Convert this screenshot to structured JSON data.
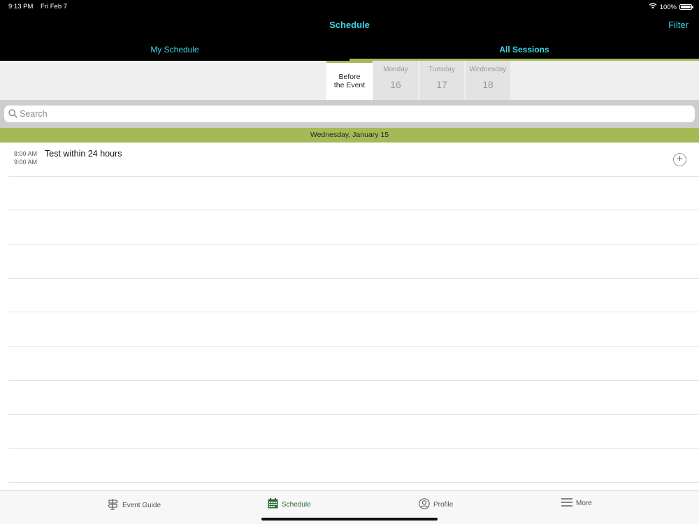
{
  "status": {
    "time": "9:13 PM",
    "date": "Fri Feb 7",
    "battery": "100%"
  },
  "nav": {
    "title": "Schedule",
    "filter": "Filter"
  },
  "segments": {
    "left": "My Schedule",
    "right": "All Sessions",
    "selected": "All Sessions"
  },
  "days": [
    {
      "name": "Before the Event",
      "line1": "Before",
      "line2": "the Event",
      "number": ""
    },
    {
      "name": "Monday",
      "number": "16"
    },
    {
      "name": "Tuesday",
      "number": "17"
    },
    {
      "name": "Wednesday",
      "number": "18"
    }
  ],
  "search": {
    "placeholder": "Search"
  },
  "section": {
    "date": "Wednesday, January 15"
  },
  "sessions": [
    {
      "start": "8:00 AM",
      "end": "9:00 AM",
      "title": "Test within 24 hours",
      "add_icon": "plus-circle-icon"
    }
  ],
  "tabs": [
    {
      "label": "Event Guide",
      "icon": "signpost-icon"
    },
    {
      "label": "Schedule",
      "icon": "calendar-icon",
      "active": true
    },
    {
      "label": "Profile",
      "icon": "person-icon"
    },
    {
      "label": "More",
      "icon": "menu-icon"
    }
  ],
  "colors": {
    "accent": "#3ad6e6",
    "green": "#a6b957",
    "tab_active": "#2d6a35"
  }
}
